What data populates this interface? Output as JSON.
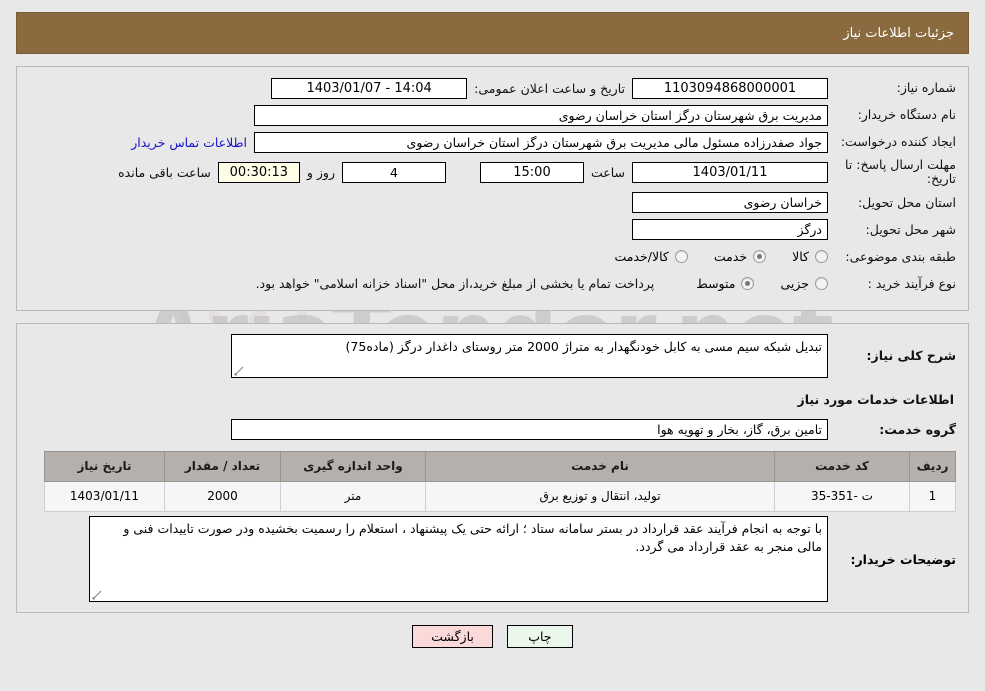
{
  "header": {
    "title": "جزئیات اطلاعات نیاز"
  },
  "colors": {
    "header_bg": "#8a6a3f",
    "link": "#1414cc",
    "table_header_bg": "#b5b0ab",
    "print_button_bg": "#eaf7ea",
    "back_button_bg": "#fbd9d9",
    "countdown_bg": "#fefde8"
  },
  "form": {
    "need_number_label": "شماره نیاز:",
    "need_number_value": "1103094868000001",
    "announce_datetime_label": "تاریخ و ساعت اعلان عمومی:",
    "announce_datetime_value": "1403/01/07 - 14:04",
    "buyer_org_label": "نام دستگاه خریدار:",
    "buyer_org_value": "مدیریت برق شهرستان درگز استان خراسان رضوی",
    "requester_label": "ایجاد کننده درخواست:",
    "requester_value": "جواد صفدرزاده مسئول مالی  مدیریت برق شهرستان درگز استان خراسان رضوی",
    "buyer_contact_link": "اطلاعات تماس خریدار",
    "deadline_label": "مهلت ارسال پاسخ: تا تاریخ:",
    "deadline_date_value": "1403/01/11",
    "deadline_hour_label": "ساعت",
    "deadline_hour_value": "15:00",
    "remaining_days_value": "4",
    "remaining_days_label": "روز و",
    "remaining_time_value": "00:30:13",
    "remaining_time_label": "ساعت باقی مانده",
    "province_label": "استان محل تحویل:",
    "province_value": "خراسان رضوی",
    "city_label": "شهر محل تحویل:",
    "city_value": "درگز",
    "category_label": "طبقه بندی موضوعی:",
    "category_options": [
      {
        "label": "کالا",
        "selected": false
      },
      {
        "label": "خدمت",
        "selected": true
      },
      {
        "label": "کالا/خدمت",
        "selected": false
      }
    ],
    "process_label": "نوع فرآیند خرید :",
    "process_options": [
      {
        "label": "جزیی",
        "selected": false
      },
      {
        "label": "متوسط",
        "selected": true
      }
    ],
    "payment_note": "پرداخت تمام یا بخشی از مبلغ خرید،از محل \"اسناد خزانه اسلامی\" خواهد بود."
  },
  "description": {
    "label": "شرح کلی نیاز:",
    "value": "تبدیل شبکه سیم مسی به کابل خودنگهدار به متراژ 2000 متر روستای داغدار درگز (ماده75)"
  },
  "services_section": {
    "title": "اطلاعات خدمات مورد نیاز",
    "group_label": "گروه خدمت:",
    "group_value": "تامین برق، گاز، بخار و تهویه هوا"
  },
  "table": {
    "headers": [
      "ردیف",
      "کد خدمت",
      "نام خدمت",
      "واحد اندازه گیری",
      "تعداد / مقدار",
      "تاریخ نیاز"
    ],
    "rows": [
      {
        "row_no": "1",
        "service_code": "ت -351-35",
        "service_name": "تولید، انتقال و توزیع برق",
        "unit": "متر",
        "quantity": "2000",
        "need_date": "1403/01/11"
      }
    ]
  },
  "buyer_notes": {
    "label": "توضیحات خریدار:",
    "value": "با توجه به انجام فرآیند عقد قرارداد در بستر سامانه ستاد ؛ ارائه حتی یک پیشنهاد ، استعلام را رسمیت بخشیده ودر صورت تاییدات فنی و مالی منجر به عقد قرارداد می گردد."
  },
  "footer": {
    "print_button": "چاپ",
    "back_button": "بازگشت"
  }
}
